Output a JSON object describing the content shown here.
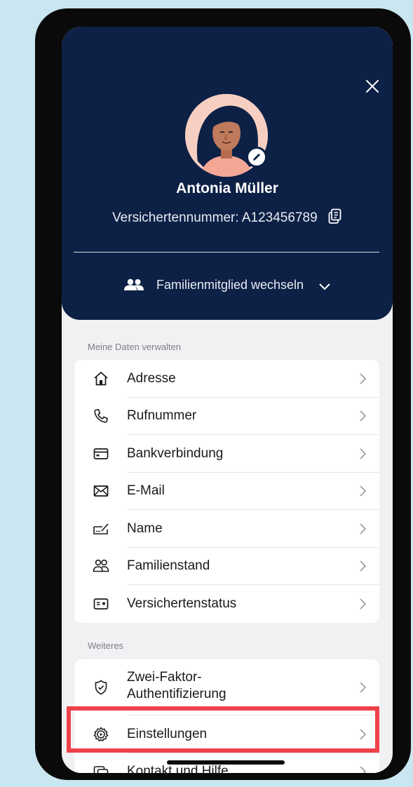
{
  "header": {
    "close_icon": "close-icon",
    "user_name": "Antonia Müller",
    "insurance_label": "Versichertennummer: A123456789",
    "family_switch_label": "Familienmitglied wechseln"
  },
  "sections": {
    "my_data": {
      "title": "Meine Daten verwalten",
      "items": [
        {
          "label": "Adresse",
          "icon": "home-icon"
        },
        {
          "label": "Rufnummer",
          "icon": "phone-icon"
        },
        {
          "label": "Bankverbindung",
          "icon": "credit-card-icon"
        },
        {
          "label": "E-Mail",
          "icon": "mail-icon"
        },
        {
          "label": "Name",
          "icon": "signature-icon"
        },
        {
          "label": "Familienstand",
          "icon": "people-icon"
        },
        {
          "label": "Versichertenstatus",
          "icon": "id-card-icon"
        }
      ]
    },
    "more": {
      "title": "Weiteres",
      "items": [
        {
          "label": "Zwei-Faktor-\nAuthentifizierung",
          "icon": "shield-check-icon"
        },
        {
          "label": "Einstellungen",
          "icon": "gear-icon"
        },
        {
          "label": "Kontakt und Hilfe",
          "icon": "chat-icon"
        }
      ]
    }
  },
  "colors": {
    "header_bg": "#0d2045",
    "highlight": "#ee4149",
    "page_bg": "#c9e6f1"
  }
}
